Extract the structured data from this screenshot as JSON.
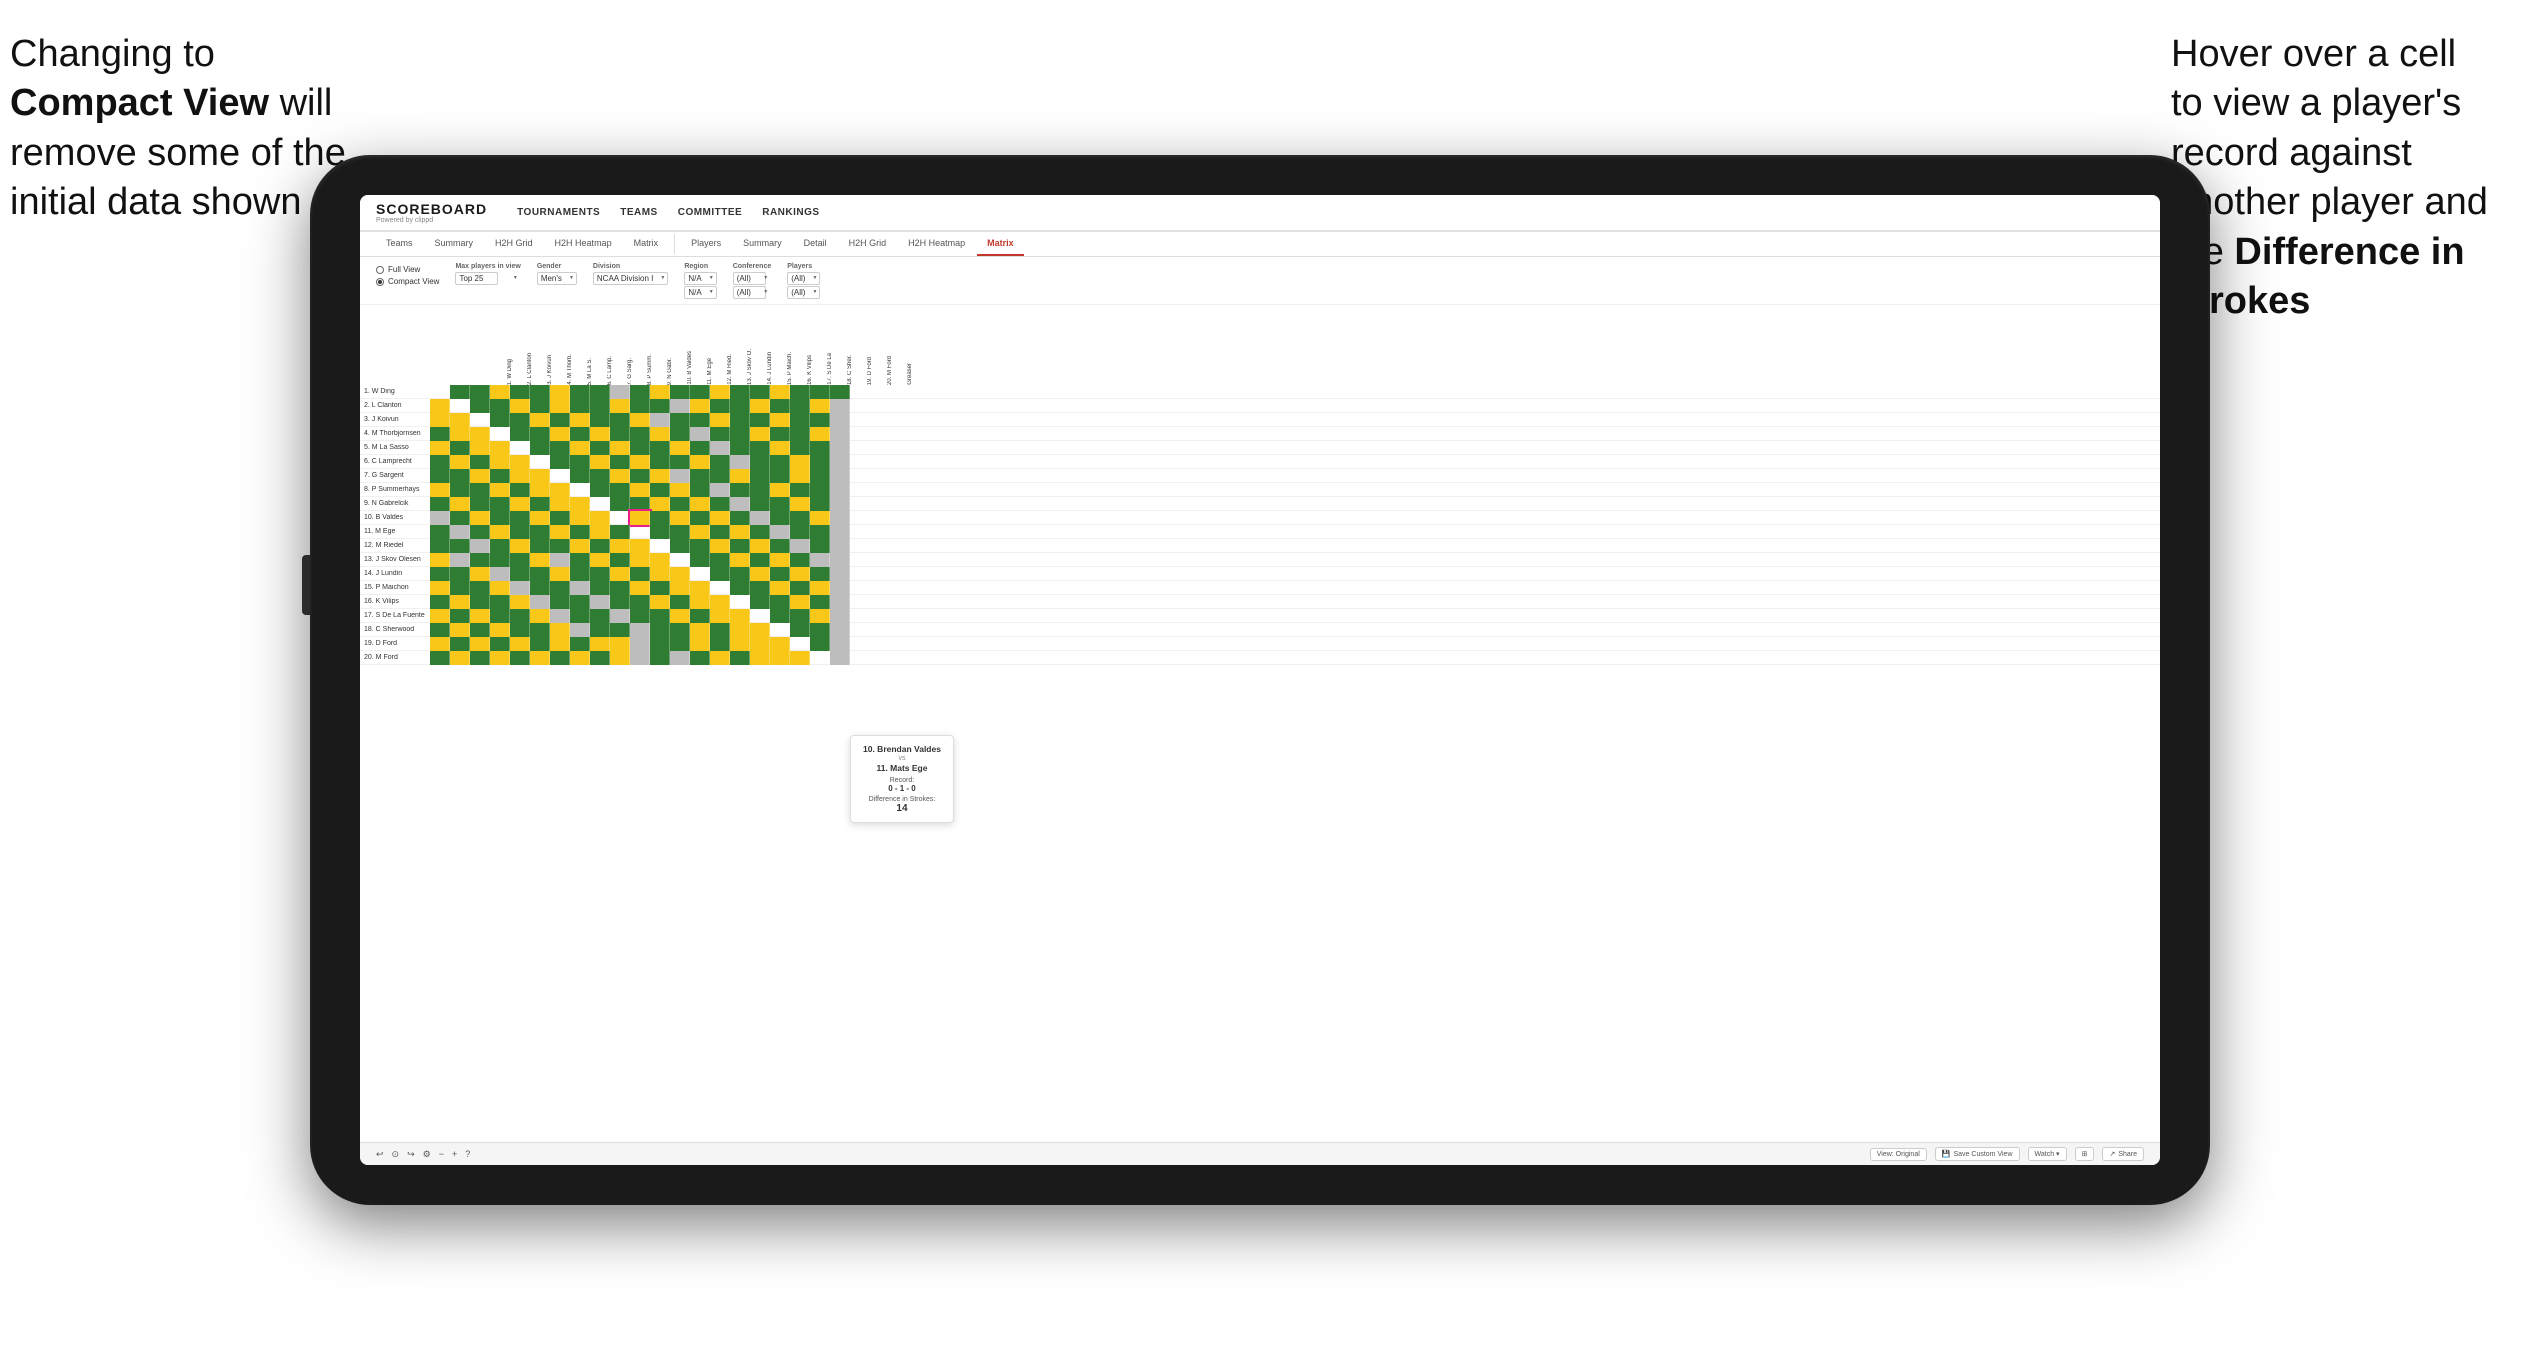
{
  "annotations": {
    "left": {
      "line1": "Changing to",
      "line2_bold": "Compact View",
      "line2_normal": " will",
      "line3": "remove some of the",
      "line4": "initial data shown"
    },
    "right": {
      "line1": "Hover over a cell",
      "line2": "to view a player's",
      "line3": "record against",
      "line4": "another player and",
      "line5_prefix": "the ",
      "line5_bold": "Difference in",
      "line6_bold": "Strokes"
    }
  },
  "app": {
    "logo": "SCOREBOARD",
    "logo_sub": "Powered by clippd",
    "nav_links": [
      "TOURNAMENTS",
      "TEAMS",
      "COMMITTEE",
      "RANKINGS"
    ],
    "sub_tabs_left": [
      "Teams",
      "Summary",
      "H2H Grid",
      "H2H Heatmap",
      "Matrix"
    ],
    "sub_tabs_right": [
      "Players",
      "Summary",
      "Detail",
      "H2H Grid",
      "H2H Heatmap",
      "Matrix"
    ],
    "active_tab": "Matrix",
    "view_options": [
      "Full View",
      "Compact View"
    ],
    "selected_view": "Compact View",
    "filters": {
      "max_players_label": "Max players in view",
      "max_players_value": "Top 25",
      "gender_label": "Gender",
      "gender_value": "Men's",
      "division_label": "Division",
      "division_value": "NCAA Division I",
      "region_label": "Region",
      "region_values": [
        "N/A",
        "N/A"
      ],
      "conference_label": "Conference",
      "conference_values": [
        "(All)",
        "(All)"
      ],
      "players_label": "Players",
      "players_values": [
        "(All)",
        "(All)"
      ]
    },
    "players": [
      "1. W Ding",
      "2. L Clanton",
      "3. J Koivun",
      "4. M Thorbjornsen",
      "5. M La Sasso",
      "6. C Lamprecht",
      "7. G Sargent",
      "8. P Summerhays",
      "9. N Gabrelcik",
      "10. B Valdes",
      "11. M Ege",
      "12. M Riedel",
      "13. J Skov Olesen",
      "14. J Lundin",
      "15. P Maichon",
      "16. K Vilips",
      "17. S De La Fuente",
      "18. C Sherwood",
      "19. D Ford",
      "20. M Ford"
    ],
    "col_headers": [
      "1. W Ding",
      "2. L Clanton",
      "3. J Koivun",
      "4. M Thorb...",
      "5. M La S...",
      "6. C Lamp...",
      "7. G Sarg...",
      "8. P Summ...",
      "9. N Gabr...",
      "10. B Valdes",
      "11. M Ege",
      "12. M Ried...",
      "13. J Skov...",
      "14. J Lund...",
      "15. P Maich...",
      "16. K Vilips",
      "17. S De La...",
      "18. C Sher...",
      "19. D Ford",
      "20. M Ford",
      "Greaser"
    ],
    "tooltip": {
      "player1": "10. Brendan Valdes",
      "vs": "vs",
      "player2": "11. Mats Ege",
      "record_label": "Record:",
      "record": "0 - 1 - 0",
      "diff_label": "Difference in Strokes:",
      "diff": "14"
    },
    "toolbar": {
      "undo": "↩",
      "redo": "↪",
      "zoom_out": "−",
      "zoom_in": "+",
      "view_original": "View: Original",
      "save_custom": "Save Custom View",
      "watch": "Watch ▾",
      "share": "Share"
    }
  }
}
